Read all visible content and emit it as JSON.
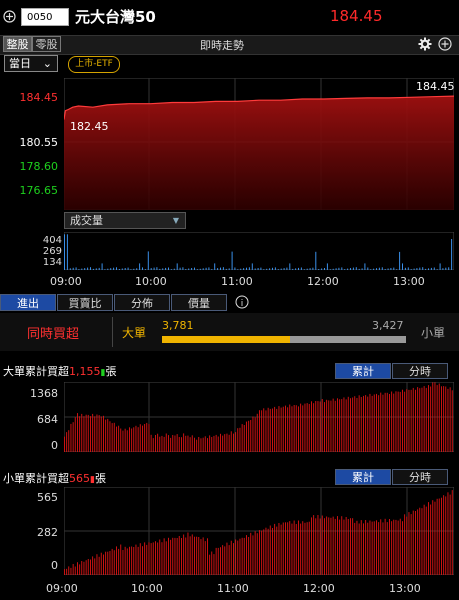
{
  "header": {
    "code": "0050",
    "name": "元大台灣50",
    "price": "184.45"
  },
  "toolbar": {
    "tab_whole": "整股",
    "tab_odd": "零股",
    "title": "即時走勢",
    "period": "當日",
    "etf_tag": "上市-ETF"
  },
  "price_chart": {
    "y_labels": [
      "184.45",
      "180.55",
      "178.60",
      "176.65"
    ],
    "last_label": "184.45",
    "open_label": "182.45",
    "ylim": [
      174.7,
      186.0
    ],
    "series": [
      [
        0,
        182.45
      ],
      [
        1,
        183.2
      ],
      [
        3,
        183.3
      ],
      [
        6,
        183.5
      ],
      [
        10,
        183.6
      ],
      [
        20,
        183.5
      ],
      [
        30,
        183.7
      ],
      [
        45,
        183.8
      ],
      [
        60,
        183.8
      ],
      [
        75,
        183.9
      ],
      [
        90,
        183.9
      ],
      [
        105,
        184.0
      ],
      [
        120,
        184.0
      ],
      [
        135,
        184.1
      ],
      [
        150,
        184.1
      ],
      [
        165,
        184.2
      ],
      [
        180,
        184.2
      ],
      [
        195,
        184.25
      ],
      [
        210,
        184.3
      ],
      [
        225,
        184.3
      ],
      [
        240,
        184.35
      ],
      [
        255,
        184.4
      ],
      [
        270,
        184.45
      ]
    ]
  },
  "volume": {
    "selector": "成交量",
    "y_labels": [
      "404",
      "269",
      "134"
    ],
    "ymax": 404
  },
  "x_labels": [
    "09:00",
    "10:00",
    "11:00",
    "12:00",
    "13:00"
  ],
  "tabs": [
    "進出",
    "買賣比",
    "分佈",
    "價量"
  ],
  "big_small": {
    "label": "同時買超",
    "big": "大單",
    "small": "小單",
    "big_value": "3,781",
    "small_value": "3,427",
    "ratio": 0.525
  },
  "big_chart": {
    "title": "大單累計買超",
    "value": "1,155",
    "unit": "張",
    "btn_cum": "累計",
    "btn_time": "分時",
    "y_labels": [
      "1368",
      "684",
      "0"
    ],
    "ymax": 1368
  },
  "small_chart": {
    "title": "小單累計買超",
    "value": "565",
    "unit": "張",
    "btn_cum": "累計",
    "btn_time": "分時",
    "y_labels": [
      "565",
      "282",
      "0"
    ],
    "ymax": 600
  }
}
